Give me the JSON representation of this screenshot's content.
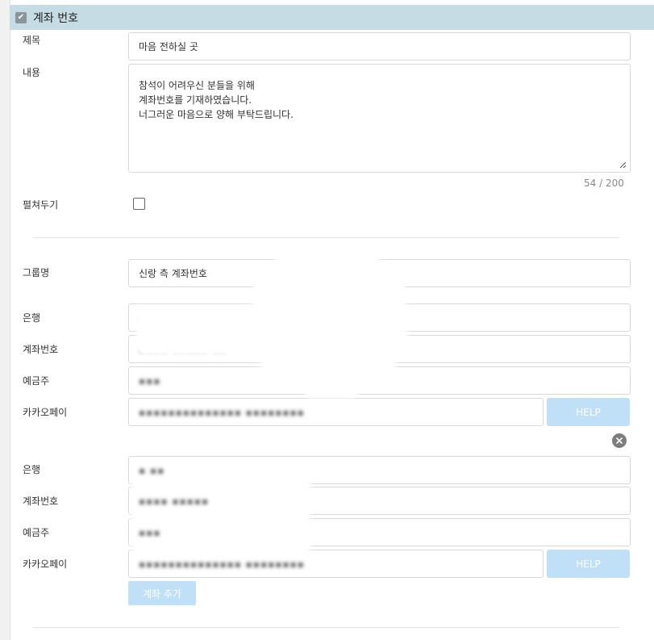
{
  "section": {
    "title": "계좌 번호",
    "checked": true
  },
  "message": {
    "title_label": "제목",
    "title_value": "마음 전하실 곳",
    "content_label": "내용",
    "content_lines": [
      "참석이 어려우신 분들을 위해",
      "계좌번호를 기재하였습니다.",
      "너그러운 마음으로 양해 부탁드립니다."
    ],
    "counter": "54 / 200",
    "expand_label": "펼쳐두기"
  },
  "group": {
    "label": "그룹명",
    "value": "신랑 측 계좌번호"
  },
  "accounts": [
    {
      "bank_label": "은행",
      "bank_value": "▪ ▪▪▪",
      "number_label": "계좌번호",
      "number_value": "▪▪▪▪ ▪▪▪▪▪ ▪▪",
      "holder_label": "예금주",
      "holder_value": "▪▪▪",
      "kakaopay_label": "카카오페이",
      "kakaopay_value": "▪▪▪▪▪▪▪▪▪▪▪▪▪▪ ▪▪▪▪▪▪▪▪",
      "help_label": "HELP"
    },
    {
      "bank_label": "은행",
      "bank_value": "▪ ▪▪",
      "number_label": "계좌번호",
      "number_value": "▪▪▪▪ ▪▪▪▪▪",
      "holder_label": "예금주",
      "holder_value": "▪▪▪",
      "kakaopay_label": "카카오페이",
      "kakaopay_value": "▪▪▪▪▪▪▪▪▪▪▪▪▪▪ ▪▪▪▪▪▪▪▪",
      "help_label": "HELP"
    }
  ],
  "add_account_label": "계좌 추가",
  "colors": {
    "header_bg": "#c6dce5",
    "button_bg": "#bfe0f7",
    "remove_bg": "#7d7d7d"
  }
}
